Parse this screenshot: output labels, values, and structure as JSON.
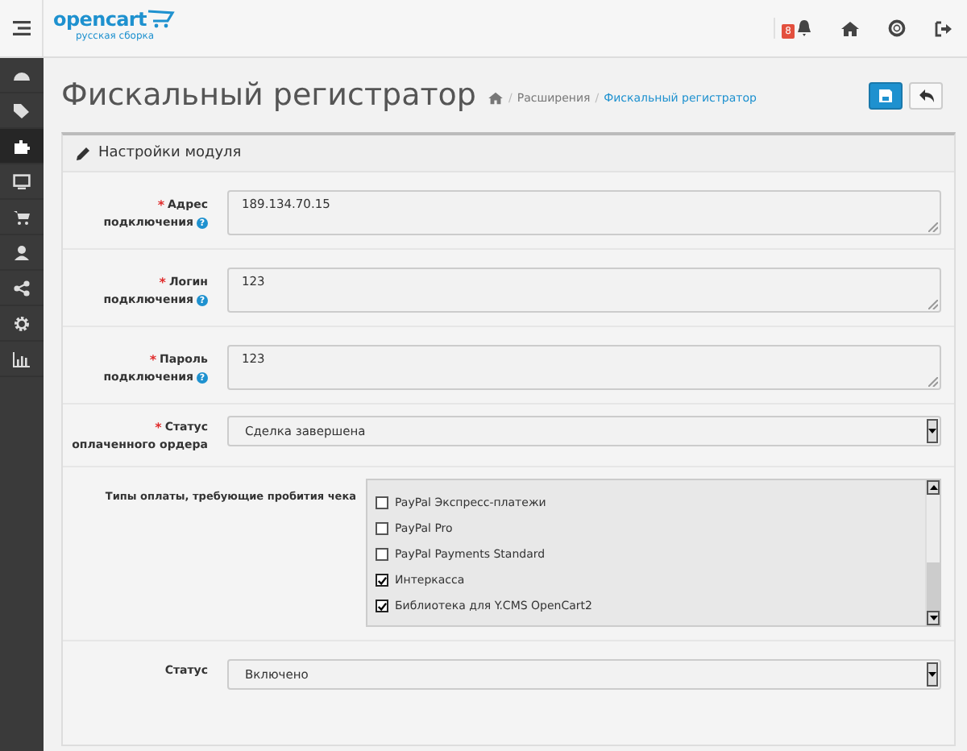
{
  "header": {
    "logo": "opencart",
    "logo_sub": "русская сборка",
    "notification_count": "8"
  },
  "sidebar": {
    "items": [
      {
        "selected": false
      },
      {
        "selected": false
      },
      {
        "selected": true
      },
      {
        "selected": false
      },
      {
        "selected": false
      },
      {
        "selected": false
      },
      {
        "selected": false
      },
      {
        "selected": false
      },
      {
        "selected": false
      }
    ]
  },
  "page": {
    "title": "Фискальный регистратор",
    "breadcrumb": {
      "separator": "/",
      "items": [
        "Расширения",
        "Фискальный регистратор"
      ]
    }
  },
  "panel": {
    "title": "Настройки модуля",
    "fields": [
      {
        "kind": "textarea",
        "label_1": "Адрес",
        "label_2": "подключения",
        "required_mark": "*",
        "help": "?",
        "value": "189.134.70.15"
      },
      {
        "kind": "textarea",
        "label_1": "Логин",
        "label_2": "подключения",
        "required_mark": "*",
        "help": "?",
        "value": "123"
      },
      {
        "kind": "textarea",
        "label_1": "Пароль",
        "label_2": "подключения",
        "required_mark": "*",
        "help": "?",
        "value": "123"
      },
      {
        "kind": "select",
        "label_1": "Статус",
        "label_2": "оплаченного ордера",
        "required_mark": "*",
        "value": "Сделка завершена"
      },
      {
        "kind": "checklist",
        "label_1": "Типы оплаты, требующие пробития чека",
        "options": [
          {
            "label": "PayPal Экспресс-платежи",
            "checked": false
          },
          {
            "label": "PayPal Pro",
            "checked": false
          },
          {
            "label": "PayPal Payments Standard",
            "checked": false
          },
          {
            "label": "Интеркасса",
            "checked": true
          },
          {
            "label": "Библиотека для Y.CMS OpenCart2",
            "checked": true
          }
        ]
      },
      {
        "kind": "select",
        "label_1": "Статус",
        "value": "Включено"
      }
    ]
  }
}
